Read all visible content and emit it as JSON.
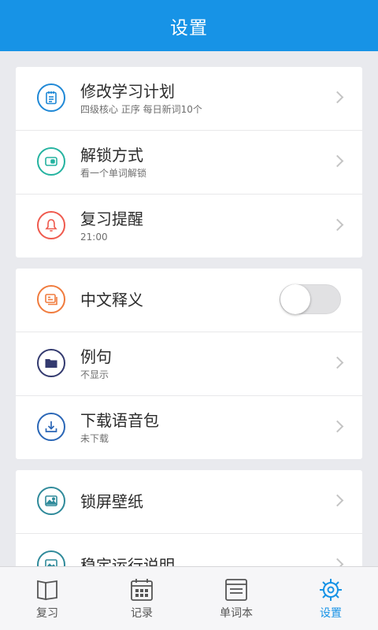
{
  "header": {
    "title": "设置"
  },
  "groups": [
    {
      "items": [
        {
          "icon": "study-plan-icon",
          "title": "修改学习计划",
          "subtitle": "四级核心 正序 每日新词10个"
        },
        {
          "icon": "unlock-mode-icon",
          "title": "解锁方式",
          "subtitle": "看一个单词解锁"
        },
        {
          "icon": "bell-icon",
          "title": "复习提醒",
          "subtitle": "21:00"
        }
      ]
    },
    {
      "items": [
        {
          "icon": "translation-icon",
          "title": "中文释义",
          "toggle_on": false
        },
        {
          "icon": "folder-icon",
          "title": "例句",
          "subtitle": "不显示"
        },
        {
          "icon": "download-icon",
          "title": "下载语音包",
          "subtitle": "未下载"
        }
      ]
    },
    {
      "items": [
        {
          "icon": "wallpaper-icon",
          "title": "锁屏壁纸"
        },
        {
          "icon": "info-image-icon",
          "title": "稳定运行说明"
        }
      ]
    }
  ],
  "tabbar": {
    "tabs": [
      {
        "label": "复习",
        "icon": "book-icon",
        "active": false
      },
      {
        "label": "记录",
        "icon": "calendar-icon",
        "active": false
      },
      {
        "label": "单词本",
        "icon": "wordbook-icon",
        "active": false
      },
      {
        "label": "设置",
        "icon": "settings-gear-icon",
        "active": true
      }
    ]
  },
  "colors": {
    "accent": "#1793e6",
    "background": "#e9eaee"
  }
}
